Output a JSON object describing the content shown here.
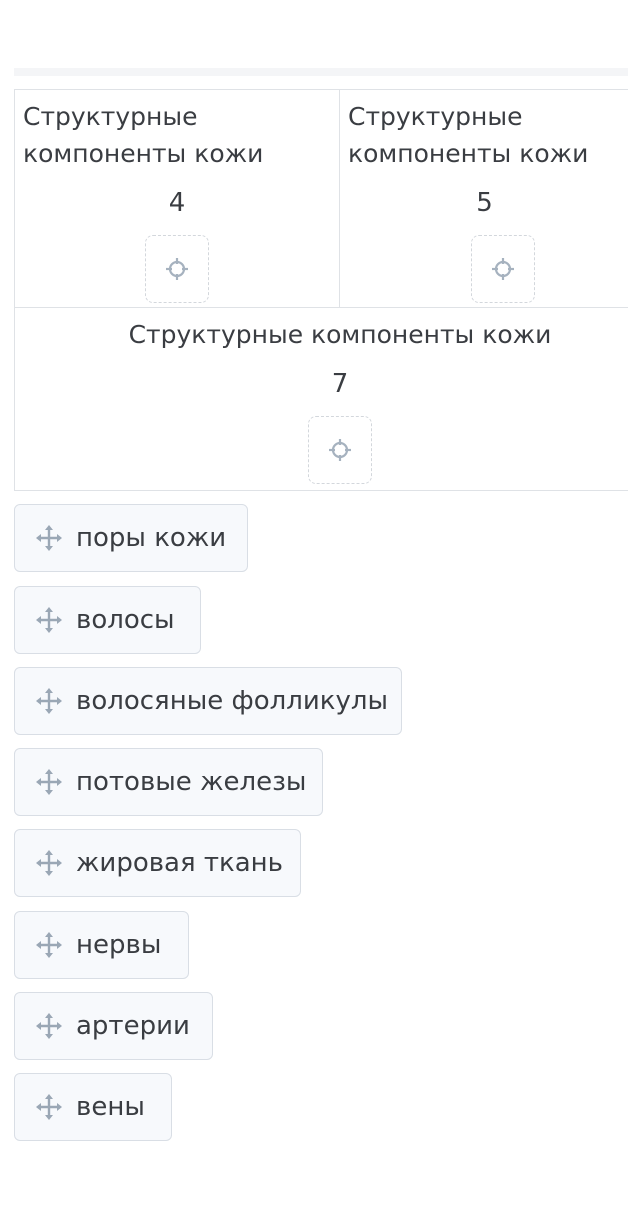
{
  "categories": [
    {
      "title": "Структурные компоненты кожи",
      "number": "4"
    },
    {
      "title": "Структурные компоненты кожи",
      "number": "5"
    },
    {
      "title": "Структурные компоненты кожи",
      "number": "7"
    }
  ],
  "items": [
    {
      "label": "поры кожи"
    },
    {
      "label": "волосы"
    },
    {
      "label": "волосяные фолликулы"
    },
    {
      "label": "потовые железы"
    },
    {
      "label": "жировая ткань"
    },
    {
      "label": "нервы"
    },
    {
      "label": "артерии"
    },
    {
      "label": "вены"
    }
  ],
  "icons": {
    "drop_target": "crosshair-icon",
    "drag_handle": "move-arrows-icon"
  },
  "colors": {
    "icon": "#9aa7b5",
    "chip_bg": "#f7f9fc",
    "border": "#d9dee5"
  }
}
